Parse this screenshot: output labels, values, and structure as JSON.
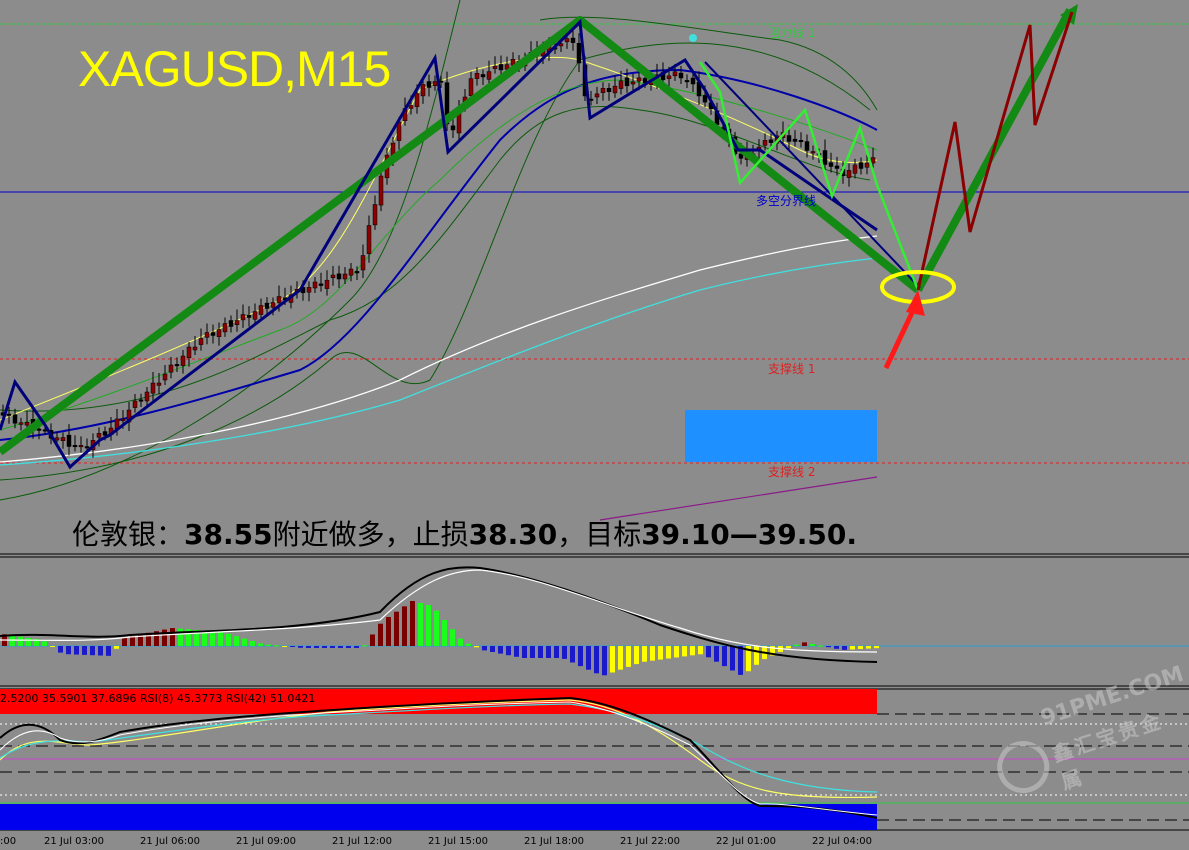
{
  "header": {
    "symbol": "XAGUSD,M15",
    "advice_prefix": "伦敦银：",
    "advice_entry": "38.55",
    "advice_mid1": "附近做多，止损",
    "advice_stop": "38.30",
    "advice_mid2": "，目标",
    "advice_target": "39.10—39.50."
  },
  "levels": {
    "resistance_1": "阻力线 1",
    "pivot": "多空分界线",
    "support_1": "支撑线 1",
    "support_2": "支撑线 2"
  },
  "rsi_readout": "2.5200 35.5901 37.6896  RSI(8) 45.3773  RSI(42) 51.0421",
  "time_axis": [
    "21 Jul 03:00",
    "21 Jul 06:00",
    "21 Jul 09:00",
    "21 Jul 12:00",
    "21 Jul 15:00",
    "21 Jul 18:00",
    "21 Jul 22:00",
    "22 Jul 01:00",
    "22 Jul 04:00"
  ],
  "time_axis_partial": ":00",
  "watermark": {
    "text": "91PME.COM",
    "sub": "鑫汇宝贵金属"
  },
  "colors": {
    "background": "#8c8c8c",
    "symbol": "#ffff00",
    "trend_green": "#138a13",
    "zigzag_navy": "#00007a",
    "forecast_red": "#8b0000",
    "arrow_red": "#ff1a1a",
    "highlight_yellow": "#ffff00",
    "buy_zone": "#1e90ff",
    "resistance_line": "#2ecc40",
    "pivot_line": "#0000cc",
    "support_line": "#e02020"
  },
  "chart_data": [
    {
      "type": "candlestick",
      "title": "XAGUSD,M15",
      "x": [
        "21 Jul 03:00",
        "21 Jul 06:00",
        "21 Jul 09:00",
        "21 Jul 12:00",
        "21 Jul 15:00",
        "21 Jul 18:00",
        "21 Jul 22:00",
        "22 Jul 01:00",
        "22 Jul 04:00"
      ],
      "close": [
        37.6,
        37.85,
        38.1,
        38.55,
        39.0,
        39.25,
        38.95,
        38.75,
        38.8
      ],
      "overlays": [
        "moving averages",
        "Bollinger bands",
        "zigzag",
        "trend lines",
        "forecast path"
      ],
      "levels": [
        {
          "name": "阻力线 1",
          "style": "dashed green"
        },
        {
          "name": "多空分界线",
          "style": "solid blue"
        },
        {
          "name": "支撑线 1",
          "style": "dashed red"
        },
        {
          "name": "支撑线 2",
          "style": "dashed red"
        }
      ],
      "annotations": [
        "伦敦银：38.55附近做多，止损38.30，目标39.10—39.50."
      ],
      "grid": false
    },
    {
      "type": "bar",
      "title": "",
      "panel": "MACD histogram",
      "series_colors": [
        "#7a0000",
        "#1aff1a",
        "#1a1acc",
        "#ffff00"
      ]
    },
    {
      "type": "line",
      "title": "",
      "panel": "RSI",
      "readout": "2.5200 35.5901 37.6896  RSI(8) 45.3773  RSI(42) 51.0421",
      "series": [
        {
          "name": "RSI(8)",
          "values": [
            45.3773
          ]
        },
        {
          "name": "RSI(42)",
          "values": [
            51.0421
          ]
        }
      ]
    }
  ]
}
